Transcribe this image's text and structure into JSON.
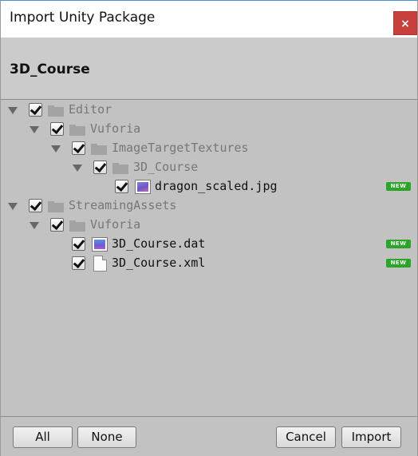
{
  "window": {
    "title": "Import Unity Package",
    "close_label": "×"
  },
  "package": {
    "name": "3D_Course"
  },
  "tree": {
    "new_badge": "NEW",
    "items": [
      {
        "label": "Editor",
        "checked": true,
        "type": "folder",
        "expanded": true,
        "dim": true
      },
      {
        "label": "Vuforia",
        "checked": true,
        "type": "folder",
        "expanded": true,
        "dim": true
      },
      {
        "label": "ImageTargetTextures",
        "checked": true,
        "type": "folder",
        "expanded": true,
        "dim": true
      },
      {
        "label": "3D_Course",
        "checked": true,
        "type": "folder",
        "expanded": true,
        "dim": true
      },
      {
        "label": "dragon_scaled.jpg",
        "checked": true,
        "type": "image-file",
        "is_new": true
      },
      {
        "label": "StreamingAssets",
        "checked": true,
        "type": "folder",
        "expanded": true,
        "dim": true
      },
      {
        "label": "Vuforia",
        "checked": true,
        "type": "folder",
        "expanded": true,
        "dim": true
      },
      {
        "label": "3D_Course.dat",
        "checked": true,
        "type": "dat-file",
        "is_new": true
      },
      {
        "label": "3D_Course.xml",
        "checked": true,
        "type": "xml-file",
        "is_new": true
      }
    ]
  },
  "footer": {
    "all_label": "All",
    "none_label": "None",
    "cancel_label": "Cancel",
    "import_label": "Import"
  }
}
